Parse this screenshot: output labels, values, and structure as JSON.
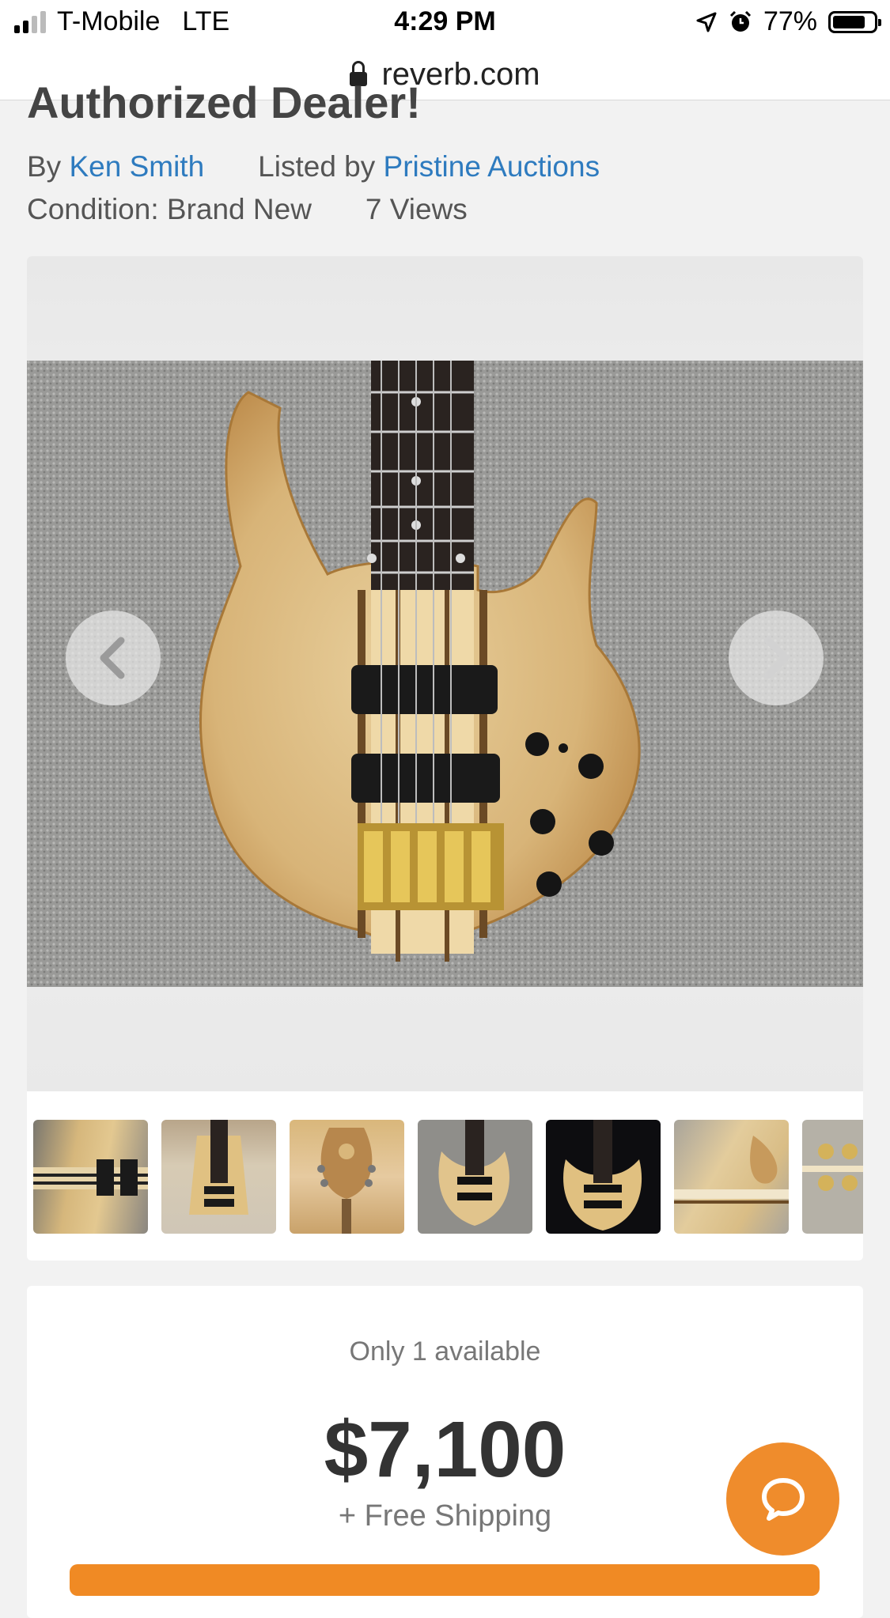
{
  "status_bar": {
    "carrier": "T-Mobile",
    "network": "LTE",
    "time": "4:29 PM",
    "battery": "77%",
    "battery_level": 0.77
  },
  "browser": {
    "url": "reverb.com"
  },
  "listing": {
    "title": "Authorized Dealer!",
    "by_prefix": "By",
    "brand": "Ken Smith",
    "listed_by_prefix": "Listed by",
    "seller": "Pristine Auctions",
    "condition": "Condition: Brand New",
    "views": "7 Views"
  },
  "gallery": {
    "main_photo_icon": "bass-guitar-photo",
    "prev_icon": "chevron-left-icon",
    "next_icon": "chevron-right-icon",
    "thumbnail_count_visible": 7
  },
  "purchase": {
    "availability": "Only 1 available",
    "price": "$7,100",
    "shipping": "+ Free Shipping"
  },
  "colors": {
    "link": "#2e7bbf",
    "accent": "#ef8c2c",
    "background": "#f2f2f2"
  }
}
